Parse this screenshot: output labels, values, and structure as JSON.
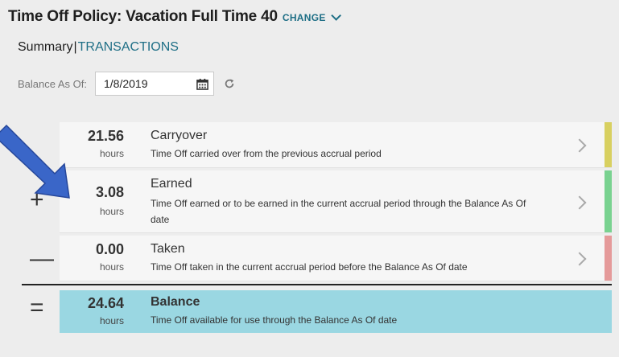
{
  "header": {
    "title": "Time Off Policy: Vacation Full Time 40",
    "change_label": "CHANGE",
    "chevron_icon": "chevron-down-icon"
  },
  "subnav": {
    "summary_label": "Summary",
    "separator": "|",
    "transactions_label": "TRANSACTIONS"
  },
  "balance_as_of": {
    "label": "Balance As Of:",
    "date_value": "1/8/2019",
    "calendar_icon": "calendar-icon",
    "refresh_icon": "refresh-icon"
  },
  "rows": [
    {
      "value": "21.56",
      "unit": "hours",
      "name": "Carryover",
      "description": "Time Off carried over from the previous accrual period",
      "stripe_color": "#d8d060"
    },
    {
      "sign": "+",
      "value": "3.08",
      "unit": "hours",
      "name": "Earned",
      "description_line1": "Time Off earned or to be earned in the current accrual period through the Balance As Of",
      "description_line2": "date",
      "stripe_color": "#79d290"
    },
    {
      "sign": "—",
      "value": "0.00",
      "unit": "hours",
      "name": "Taken",
      "description": "Time Off taken in the current accrual period before the Balance As Of date",
      "stripe_color": "#e59a9a"
    }
  ],
  "balance": {
    "sign": "=",
    "value": "24.64",
    "unit": "hours",
    "name": "Balance",
    "description": "Time Off available for use through the Balance As Of date",
    "color": "#9ad7e2"
  },
  "annotation": {
    "arrow_color": "#3a66c8"
  }
}
